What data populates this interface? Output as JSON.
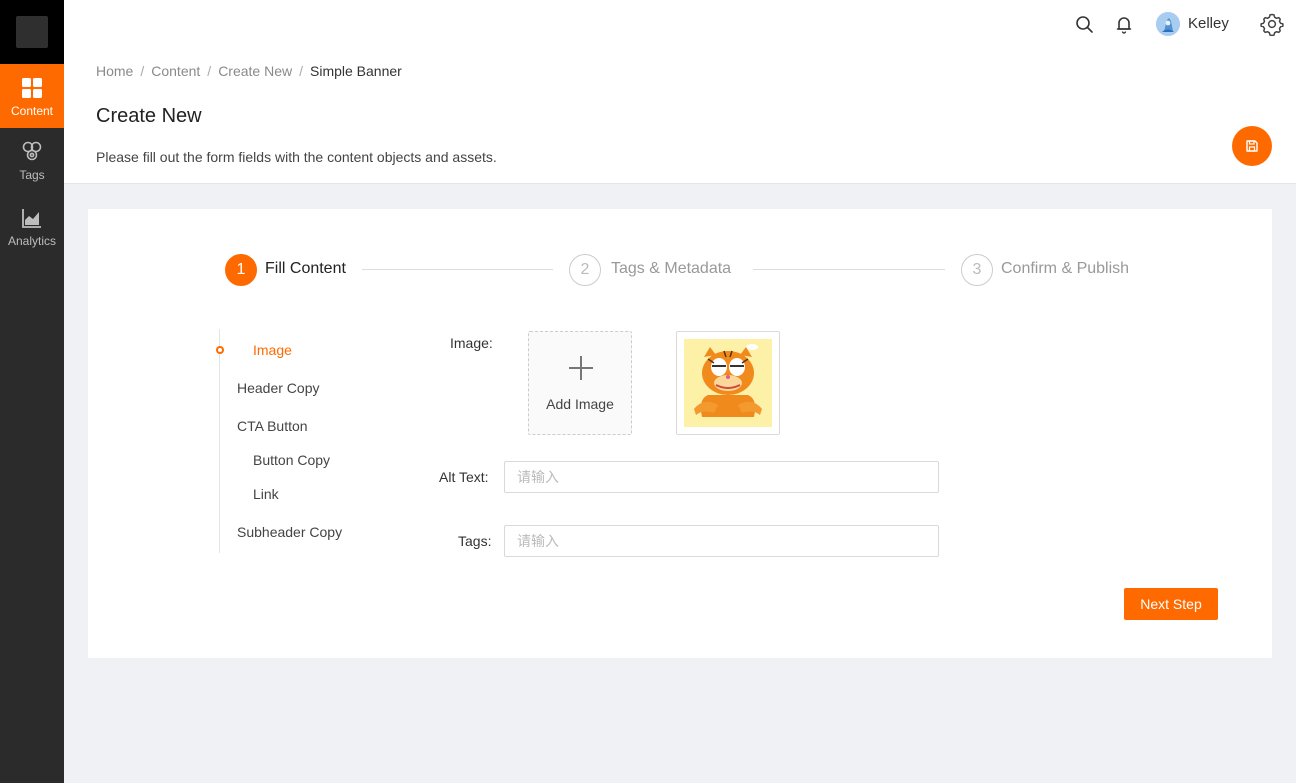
{
  "brand": {
    "accent": "#ff6a00"
  },
  "sidebar": {
    "items": [
      {
        "label": "Content",
        "icon": "grid-icon",
        "active": true
      },
      {
        "label": "Tags",
        "icon": "tags-icon",
        "active": false
      },
      {
        "label": "Analytics",
        "icon": "analytics-icon",
        "active": false
      }
    ]
  },
  "header": {
    "user_name": "Kelley",
    "icons": [
      "search-icon",
      "bell-icon",
      "avatar",
      "gear-icon"
    ]
  },
  "breadcrumb": [
    "Home",
    "Content",
    "Create New",
    "Simple Banner"
  ],
  "page": {
    "title": "Create New",
    "description": "Please fill out the form fields with the content objects and assets."
  },
  "steps": [
    {
      "number": "1",
      "label": "Fill Content",
      "status": "active"
    },
    {
      "number": "2",
      "label": "Tags & Metadata",
      "status": "wait"
    },
    {
      "number": "3",
      "label": "Confirm & Publish",
      "status": "wait"
    }
  ],
  "anchors": [
    {
      "label": "Image",
      "active": true
    },
    {
      "label": "Header Copy",
      "active": false
    },
    {
      "label": "CTA Button",
      "active": false
    },
    {
      "label": "Button Copy",
      "active": false
    },
    {
      "label": "Link",
      "active": false
    },
    {
      "label": "Subheader Copy",
      "active": false
    }
  ],
  "form": {
    "image_label": "Image:",
    "add_image_label": "Add Image",
    "alt_text_label": "Alt Text:",
    "alt_text_value": "",
    "alt_text_placeholder": "请输入",
    "tags_label": "Tags:",
    "tags_value": "",
    "tags_placeholder": "请输入"
  },
  "actions": {
    "next_label": "Next Step"
  }
}
